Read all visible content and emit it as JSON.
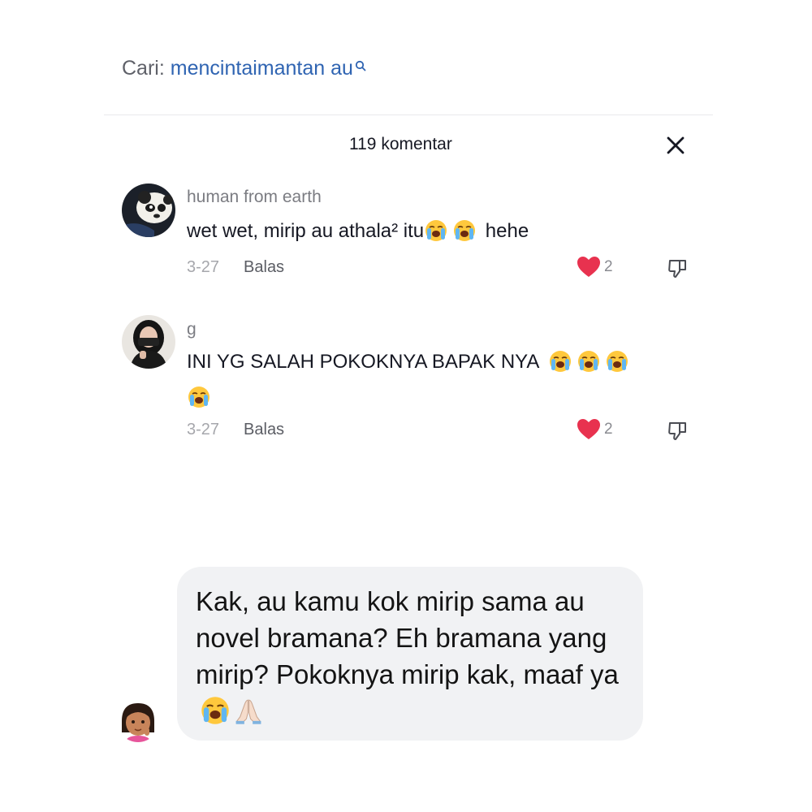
{
  "search": {
    "prefix": "Cari:",
    "query": "mencintaimantan au"
  },
  "comments_header": {
    "count_label": "119 komentar"
  },
  "comments": [
    {
      "username": "human from earth",
      "text_before": "wet wet, mirip au athala² itu",
      "text_after": "hehe",
      "emojis": [
        "loudly-crying-face-emoji",
        "loudly-crying-face-emoji"
      ],
      "date": "3-27",
      "reply_label": "Balas",
      "likes": "2"
    },
    {
      "username": "g",
      "text_before": "INI YG SALAH POKOKNYA BAPAK NYA",
      "emojis": [
        "loudly-crying-face-emoji",
        "loudly-crying-face-emoji",
        "loudly-crying-face-emoji",
        "loudly-crying-face-emoji"
      ],
      "date": "3-27",
      "reply_label": "Balas",
      "likes": "2"
    }
  ],
  "reply_bubble": {
    "text": "Kak, au kamu kok mirip sama au novel bramana? Eh bramana yang mirip? Pokoknya mirip kak, maaf ya",
    "emojis": [
      "loudly-crying-face-emoji",
      "folded-hands-emoji"
    ]
  },
  "colors": {
    "search_query": "#2f64b2",
    "heart": "#fe2c55",
    "bubble_bg": "#f1f2f4"
  }
}
